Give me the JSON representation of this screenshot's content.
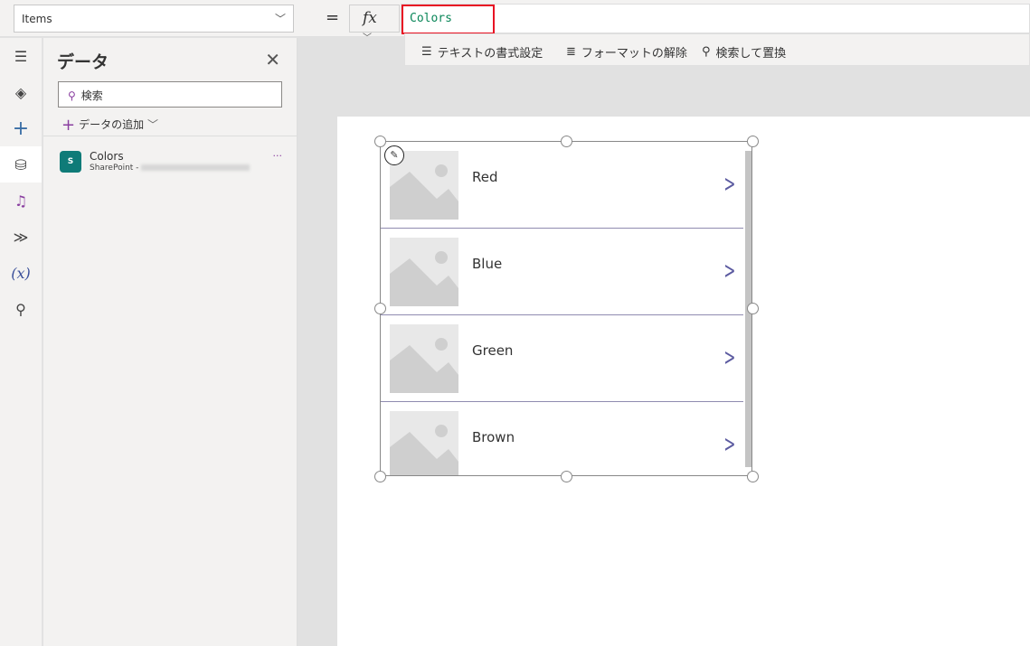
{
  "formula_bar": {
    "property": "Items",
    "equals": "=",
    "fx": "fx",
    "formula": "Colors"
  },
  "format_bar": {
    "format_text": "テキストの書式設定",
    "remove_format": "フォーマットの解除",
    "find_replace": "検索して置換"
  },
  "data_panel": {
    "title": "データ",
    "search_placeholder": "検索",
    "add_data": "データの追加",
    "sources": [
      {
        "name": "Colors",
        "type": "SharePoint - "
      }
    ]
  },
  "gallery": {
    "items": [
      {
        "title": "Red"
      },
      {
        "title": "Blue"
      },
      {
        "title": "Green"
      },
      {
        "title": "Brown"
      }
    ]
  },
  "colors": {
    "accent": "#8a3fa0",
    "highlight": "#e81123",
    "formula": "#098658",
    "chevron": "#5b5aa0"
  }
}
